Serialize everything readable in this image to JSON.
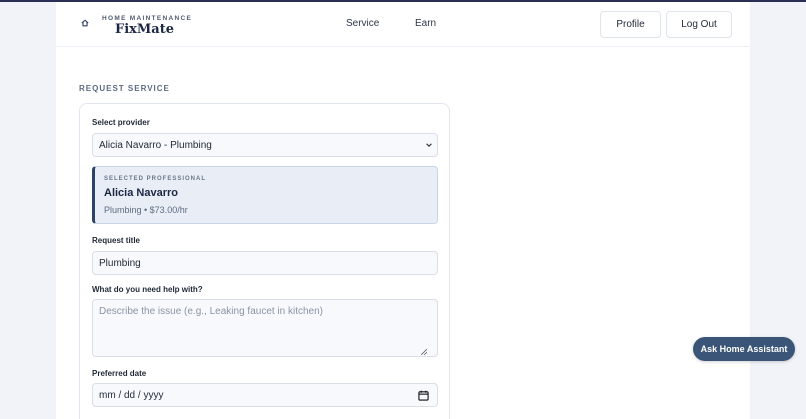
{
  "brand": {
    "tagline": "HOME MAINTENANCE",
    "name": "FixMate",
    "icon": "house-icon"
  },
  "nav": {
    "service": "Service",
    "earn": "Earn"
  },
  "header_buttons": {
    "profile": "Profile",
    "logout": "Log Out"
  },
  "form": {
    "section_label": "REQUEST SERVICE",
    "provider_label": "Select provider",
    "provider_value": "Alicia Navarro - Plumbing",
    "selected": {
      "tag": "SELECTED PROFESSIONAL",
      "name": "Alicia Navarro",
      "meta": "Plumbing • $73.00/hr"
    },
    "title_label": "Request title",
    "title_value": "Plumbing",
    "help_label": "What do you need help with?",
    "help_placeholder": "Describe the issue (e.g., Leaking faucet in kitchen)",
    "date_label": "Preferred date",
    "date_placeholder": "mm / dd / yyyy"
  },
  "assistant_button": "Ask Home Assistant",
  "colors": {
    "accent": "#2d4266",
    "assistant": "#3a5577",
    "card_highlight": "#e9eef6"
  }
}
